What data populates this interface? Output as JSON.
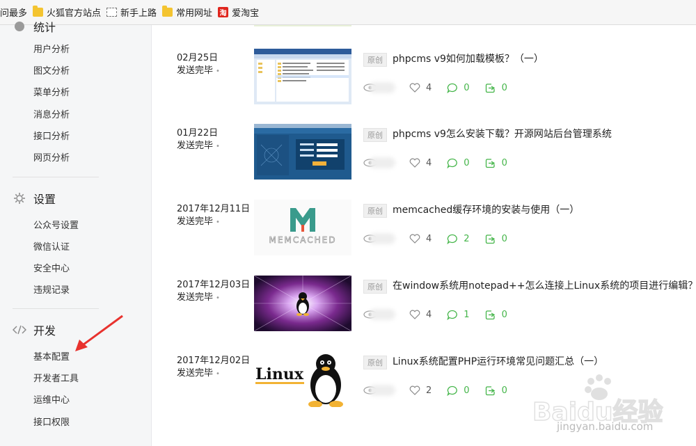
{
  "bookmarks": [
    {
      "label": "问最多",
      "icon": "none"
    },
    {
      "label": "火狐官方站点",
      "icon": "folder-icon"
    },
    {
      "label": "新手上路",
      "icon": "dotted-page-icon"
    },
    {
      "label": "常用网址",
      "icon": "folder-icon"
    },
    {
      "label": "爱淘宝",
      "icon": "taobao-icon",
      "icon_text": "淘"
    }
  ],
  "sidebar": {
    "stats_section": {
      "title": "统计"
    },
    "stats_items": [
      "用户分析",
      "图文分析",
      "菜单分析",
      "消息分析",
      "接口分析",
      "网页分析"
    ],
    "settings_section": {
      "title": "设置"
    },
    "settings_items": [
      "公众号设置",
      "微信认证",
      "安全中心",
      "违规记录"
    ],
    "dev_section": {
      "title": "开发"
    },
    "dev_items": [
      "基本配置",
      "开发者工具",
      "运维中心",
      "接口权限"
    ]
  },
  "articles": [
    {
      "date": "02月25日",
      "status": "发送完毕",
      "badge": "原创",
      "title": "phpcms v9如何加载模板？（一）",
      "likes": "4",
      "comments": "0",
      "shares": "0"
    },
    {
      "date": "01月22日",
      "status": "发送完毕",
      "badge": "原创",
      "title": "phpcms v9怎么安装下载？开源网站后台管理系统",
      "likes": "4",
      "comments": "0",
      "shares": "0"
    },
    {
      "date": "2017年12月11日",
      "status": "发送完毕",
      "badge": "原创",
      "title": "memcached缓存环境的安装与使用（一）",
      "likes": "4",
      "comments": "2",
      "shares": "0"
    },
    {
      "date": "2017年12月03日",
      "status": "发送完毕",
      "badge": "原创",
      "title": "在window系统用notepad++怎么连接上Linux系统的项目进行编辑？",
      "likes": "4",
      "comments": "1",
      "shares": "0"
    },
    {
      "date": "2017年12月02日",
      "status": "发送完毕",
      "badge": "原创",
      "title": "Linux系统配置PHP运行环境常见问题汇总（一）",
      "likes": "2",
      "comments": "0",
      "shares": "0"
    }
  ],
  "thumbs": {
    "memcached_text": "MEMCACHED",
    "linux_text": "Linux"
  },
  "watermark": {
    "brand": "Baidu经验",
    "url": "jingyan.baidu.com"
  },
  "colors": {
    "green": "#44b549",
    "arrow": "#e8322e"
  }
}
